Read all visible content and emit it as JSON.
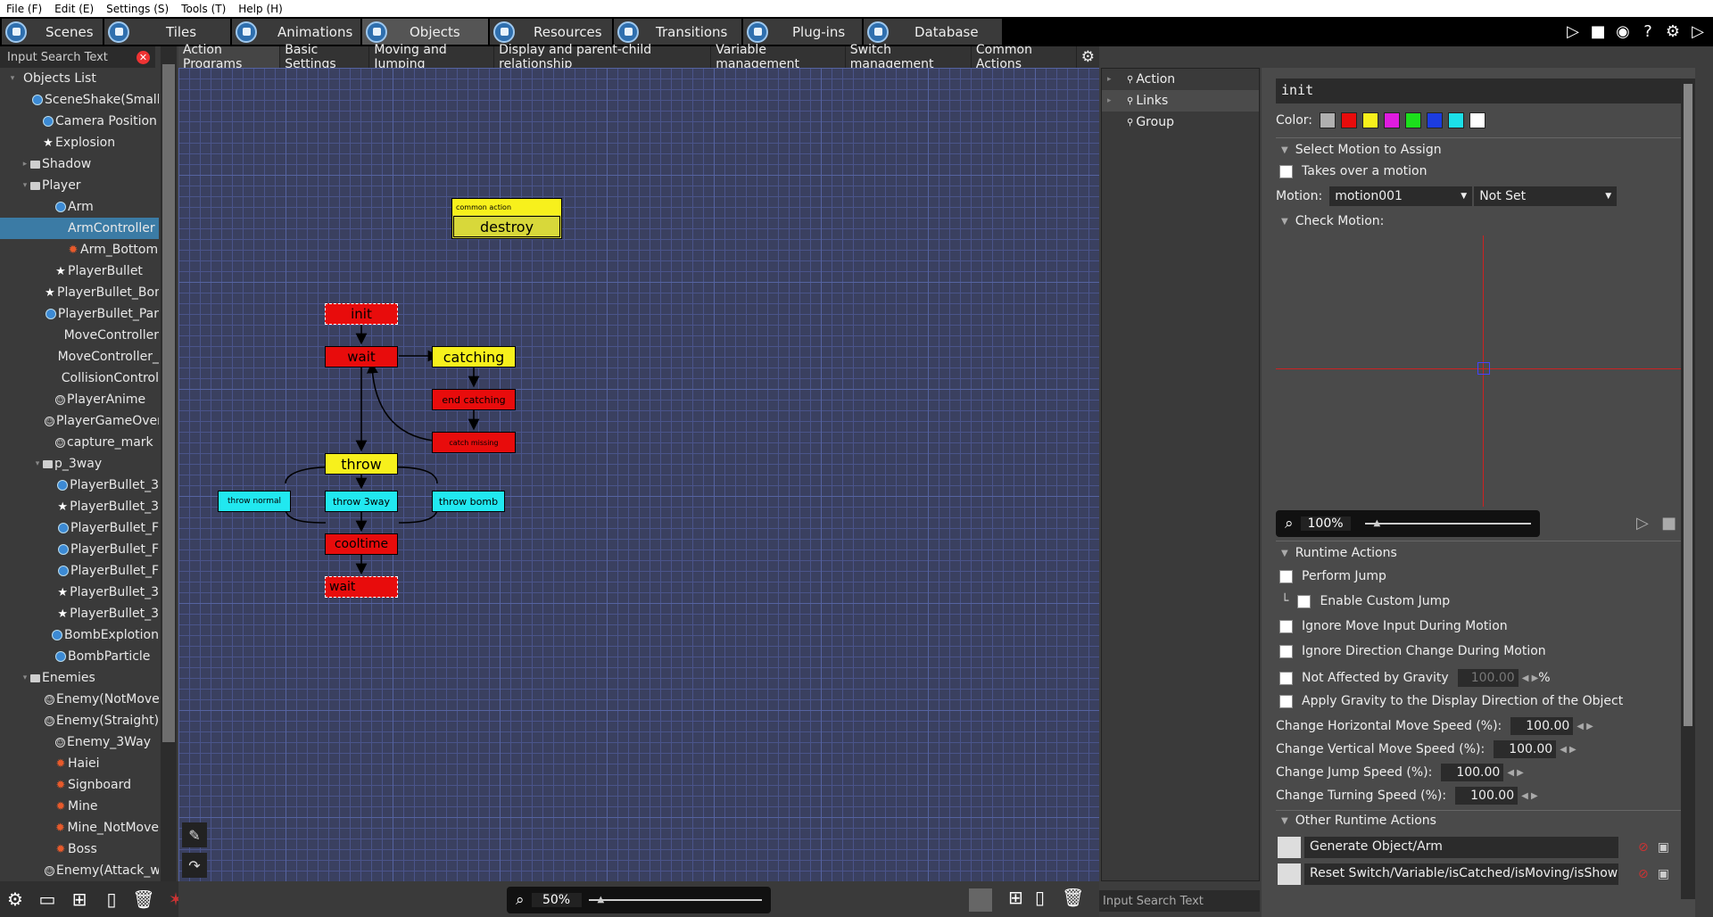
{
  "menu": [
    "File (F)",
    "Edit (E)",
    "Settings (S)",
    "Tools (T)",
    "Help (H)"
  ],
  "tabs": [
    {
      "label": "Scenes",
      "active": false
    },
    {
      "label": "Tiles",
      "active": false
    },
    {
      "label": "Animations",
      "active": false
    },
    {
      "label": "Objects",
      "active": true
    },
    {
      "label": "Resources",
      "active": false
    },
    {
      "label": "Transitions",
      "active": false
    },
    {
      "label": "Plug-ins",
      "active": false
    },
    {
      "label": "Database",
      "active": false
    }
  ],
  "objects_panel": {
    "search_placeholder": "Input Search Text",
    "header": "Objects List",
    "items": [
      {
        "label": "SceneShake(Small)",
        "icon": "object",
        "depth": 2
      },
      {
        "label": "Camera Position",
        "icon": "object",
        "depth": 2
      },
      {
        "label": "Explosion",
        "icon": "star",
        "depth": 2
      },
      {
        "label": "Shadow",
        "icon": "folder",
        "depth": 1,
        "arrow": "▸"
      },
      {
        "label": "Player",
        "icon": "folder",
        "depth": 1,
        "arrow": "▾"
      },
      {
        "label": "Arm",
        "icon": "object",
        "depth": 3
      },
      {
        "label": "ArmController",
        "icon": "none",
        "depth": 4,
        "selected": true
      },
      {
        "label": "Arm_Bottom",
        "icon": "enemy",
        "depth": 4
      },
      {
        "label": "PlayerBullet",
        "icon": "star",
        "depth": 3
      },
      {
        "label": "PlayerBullet_Bom",
        "icon": "star",
        "depth": 3
      },
      {
        "label": "PlayerBullet_Par",
        "icon": "object",
        "depth": 3
      },
      {
        "label": "MoveController",
        "icon": "none",
        "depth": 4
      },
      {
        "label": "MoveController_",
        "icon": "none",
        "depth": 4
      },
      {
        "label": "CollisionControl",
        "icon": "none",
        "depth": 4
      },
      {
        "label": "PlayerAnime",
        "icon": "monster",
        "depth": 3
      },
      {
        "label": "PlayerGameOver",
        "icon": "monster",
        "depth": 3
      },
      {
        "label": "capture_mark",
        "icon": "monster",
        "depth": 3
      },
      {
        "label": "p_3way",
        "icon": "folder",
        "depth": 2,
        "arrow": "▾"
      },
      {
        "label": "PlayerBullet_3",
        "icon": "object",
        "depth": 4
      },
      {
        "label": "PlayerBullet_3",
        "icon": "star",
        "depth": 4
      },
      {
        "label": "PlayerBullet_F",
        "icon": "object",
        "depth": 4
      },
      {
        "label": "PlayerBullet_F",
        "icon": "object",
        "depth": 4
      },
      {
        "label": "PlayerBullet_F",
        "icon": "object",
        "depth": 4
      },
      {
        "label": "PlayerBullet_3",
        "icon": "star",
        "depth": 4
      },
      {
        "label": "PlayerBullet_3",
        "icon": "star",
        "depth": 4
      },
      {
        "label": "BombExplotion",
        "icon": "object",
        "depth": 3
      },
      {
        "label": "BombParticle",
        "icon": "object",
        "depth": 3
      },
      {
        "label": "Enemies",
        "icon": "folder",
        "depth": 1,
        "arrow": "▾"
      },
      {
        "label": "Enemy(NotMove",
        "icon": "monster",
        "depth": 3
      },
      {
        "label": "Enemy(Straight)",
        "icon": "monster",
        "depth": 3
      },
      {
        "label": "Enemy_3Way",
        "icon": "monster",
        "depth": 3
      },
      {
        "label": "Haiei",
        "icon": "enemy",
        "depth": 3
      },
      {
        "label": "Signboard",
        "icon": "enemy",
        "depth": 3
      },
      {
        "label": "Mine",
        "icon": "enemy",
        "depth": 3
      },
      {
        "label": "Mine_NotMove",
        "icon": "enemy",
        "depth": 3
      },
      {
        "label": "Boss",
        "icon": "enemy",
        "depth": 3
      },
      {
        "label": "Enemy(Attack_w",
        "icon": "monster",
        "depth": 3
      }
    ]
  },
  "subtabs": [
    "Action Programs",
    "Basic Settings",
    "Moving and Jumping",
    "Display and parent-child relationship",
    "Variable management",
    "Switch management",
    "Common Actions"
  ],
  "graph": {
    "common_action_header": "common action",
    "nodes": {
      "destroy": "destroy",
      "init": "init",
      "wait1": "wait",
      "catching": "catching",
      "end_catching": "end catching",
      "catch_miss": "catch missing",
      "throw": "throw",
      "throw_normal": "throw normal",
      "throw_3way": "throw 3way",
      "throw_bomb": "throw bomb",
      "cooltime": "cooltime",
      "wait2": "wait"
    },
    "zoom": "50%"
  },
  "action_panel": {
    "items": [
      "Action",
      "Links",
      "Group"
    ],
    "search_placeholder": "Input Search Text"
  },
  "props": {
    "name": "init",
    "color_label": "Color:",
    "colors": [
      "#b0b0b0",
      "#e80c0c",
      "#f7f01c",
      "#e01ce0",
      "#1ce01c",
      "#1c3ce0",
      "#1ce0e8",
      "#ffffff"
    ],
    "select_motion": "Select Motion to Assign",
    "takes_over": "Takes over a motion",
    "motion_label": "Motion:",
    "motion_value": "motion001",
    "motion_value2": "Not Set",
    "check_motion": "Check Motion:",
    "preview_zoom": "100%",
    "runtime_actions": "Runtime Actions",
    "perform_jump": "Perform Jump",
    "custom_jump": "Enable Custom Jump",
    "ignore_move": "Ignore Move Input During Motion",
    "ignore_dir": "Ignore Direction Change During Motion",
    "not_gravity": "Not Affected by Gravity",
    "gravity_value": "100.00",
    "percent": "%",
    "apply_gravity": "Apply Gravity to the Display Direction of the Object",
    "h_speed_label": "Change Horizontal Move Speed (%):",
    "h_speed": "100.00",
    "v_speed_label": "Change Vertical Move Speed (%):",
    "v_speed": "100.00",
    "jump_speed_label": "Change Jump Speed (%):",
    "jump_speed": "100.00",
    "turn_speed_label": "Change Turning Speed (%):",
    "turn_speed": "100.00",
    "other_actions": "Other Runtime Actions",
    "other_items": [
      "Generate Object/Arm",
      "Reset Switch/Variable/isCatched/isMoving/isShow…"
    ]
  }
}
